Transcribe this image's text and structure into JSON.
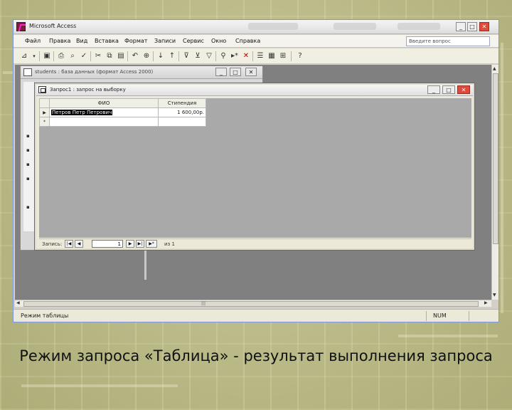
{
  "app": {
    "title": "Microsoft Access",
    "ask_placeholder": "Введите вопрос",
    "menu": [
      "Файл",
      "Правка",
      "Вид",
      "Вставка",
      "Формат",
      "Записи",
      "Сервис",
      "Окно",
      "Справка"
    ],
    "status_text": "Режим таблицы",
    "num_indicator": "NUM"
  },
  "toolbar": {
    "icons": [
      "view-icon",
      "dropdown-icon",
      "save-icon",
      "print-icon",
      "print-preview-icon",
      "spellcheck-icon",
      "cut-icon",
      "copy-icon",
      "paste-icon",
      "undo-icon",
      "insert-hyperlink-icon",
      "sort-ascending-icon",
      "sort-descending-icon",
      "filter-by-selection-icon",
      "filter-by-form-icon",
      "apply-filter-icon",
      "find-icon",
      "new-record-icon",
      "delete-record-icon",
      "properties-icon",
      "database-window-icon",
      "new-object-icon",
      "help-icon"
    ]
  },
  "db_window": {
    "title": "students : база данных (формат Access 2000)"
  },
  "query_window": {
    "title": "Запрос1 : запрос на выборку",
    "columns": [
      "ФИО",
      "Стипендия"
    ],
    "rows": [
      {
        "selector": "▶",
        "fio": "Петров Петр Петрович",
        "stipend": "1 600,00р."
      },
      {
        "selector": "*",
        "fio": "",
        "stipend": ""
      }
    ],
    "nav": {
      "label": "Запись:",
      "first": "|◀",
      "prev": "◀",
      "current": "1",
      "next": "▶",
      "last": "▶|",
      "new": "▶*",
      "of_text": "из 1"
    }
  },
  "caption": "Режим запроса «Таблица» - результат выполнения запроса"
}
